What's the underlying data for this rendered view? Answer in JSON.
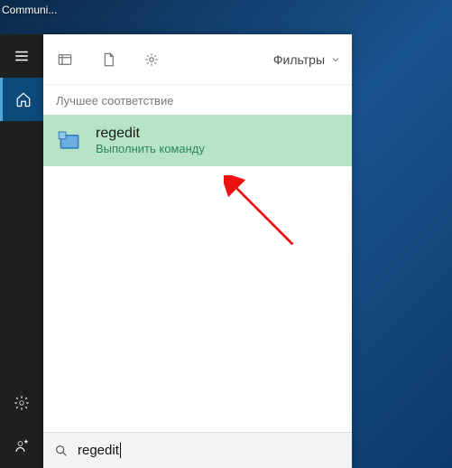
{
  "desktop": {
    "icon_caption": "Communi..."
  },
  "rail": {
    "items": [
      {
        "name": "menu-icon"
      },
      {
        "name": "home-icon",
        "active": true
      }
    ],
    "bottom_items": [
      {
        "name": "settings-icon"
      },
      {
        "name": "feedback-icon"
      }
    ]
  },
  "panel": {
    "top_icons": [
      {
        "name": "apps-icon"
      },
      {
        "name": "documents-icon"
      },
      {
        "name": "settings-small-icon"
      }
    ],
    "filters_label": "Фильтры",
    "best_match_label": "Лучшее соответствие",
    "result": {
      "title": "regedit",
      "subtitle": "Выполнить команду"
    }
  },
  "search": {
    "query": "regedit"
  }
}
